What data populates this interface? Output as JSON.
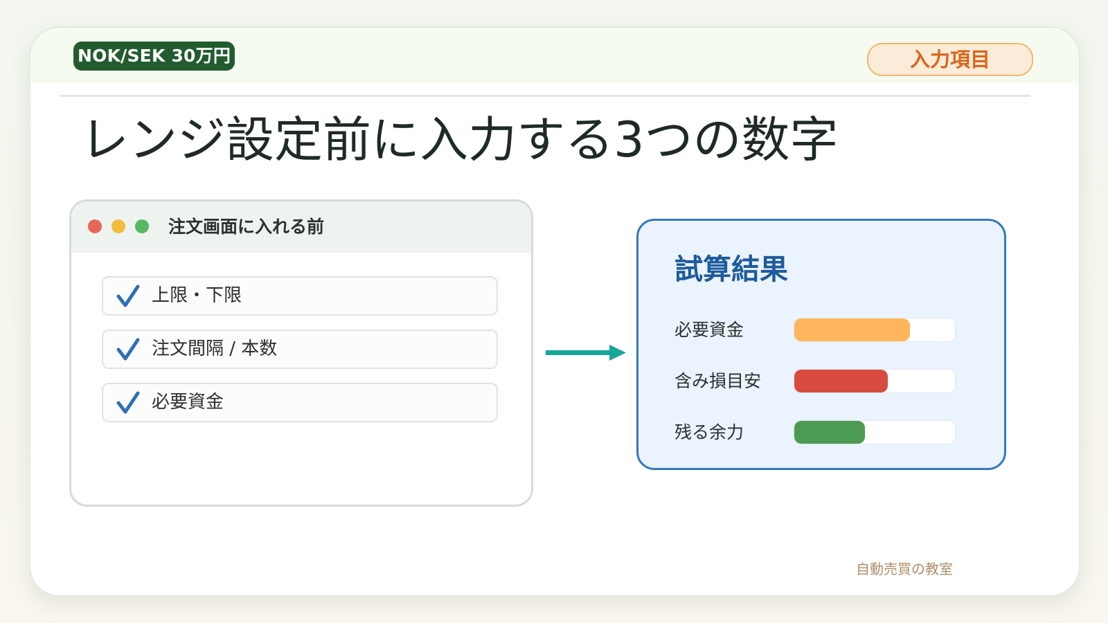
{
  "header": {
    "badge": "NOK/SEK 30万円",
    "tag": "入力項目"
  },
  "title": "レンジ設定前に入力する3つの数字",
  "window": {
    "title": "注文画面に入れる前",
    "items": [
      {
        "label": "上限・下限",
        "icon": "checkmark-icon"
      },
      {
        "label": "注文間隔 / 本数",
        "icon": "checkmark-icon"
      },
      {
        "label": "必要資金",
        "icon": "checkmark-icon"
      }
    ]
  },
  "result": {
    "title": "試算結果",
    "metrics": [
      {
        "label": "必要資金",
        "level": 0.72,
        "color": "#ffb55b"
      },
      {
        "label": "含み損目安",
        "level": 0.58,
        "color": "#d74b40"
      },
      {
        "label": "残る余力",
        "level": 0.44,
        "color": "#4d9b53"
      }
    ]
  },
  "colors": {
    "brand_green": "#225c2e",
    "accent_orange": "#d8651b",
    "arrow_teal": "#18a59a",
    "result_blue": "#3578bd",
    "check_blue": "#2f6eb7"
  },
  "footer": "自動売買の教室"
}
